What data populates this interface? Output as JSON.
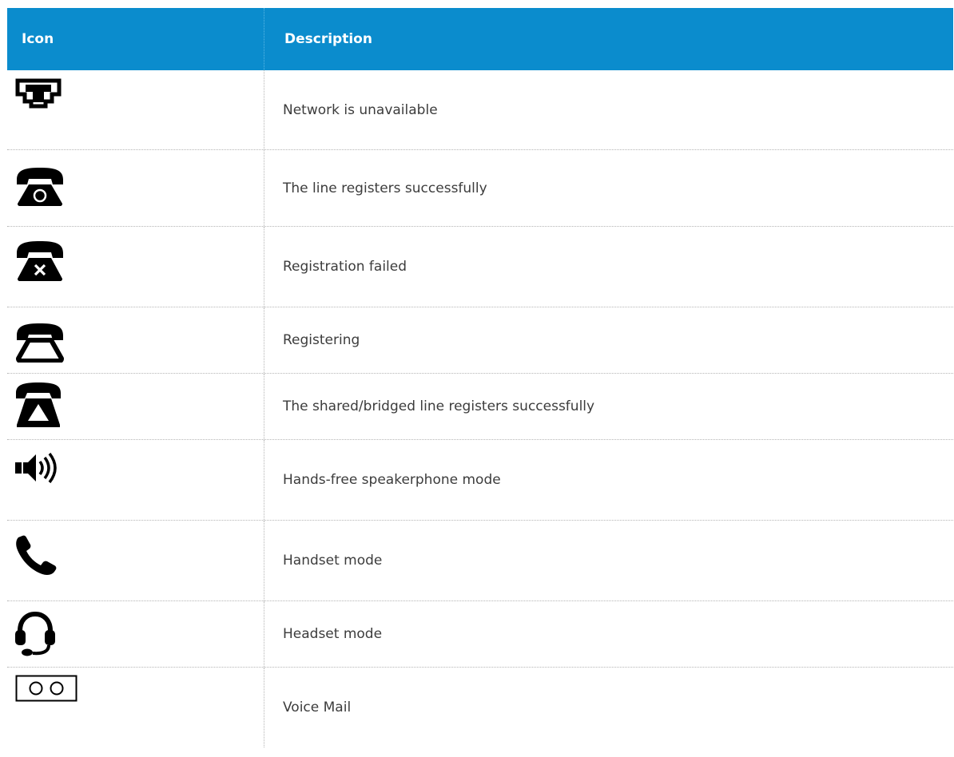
{
  "table": {
    "header": {
      "icon": "Icon",
      "description": "Description"
    },
    "rows": [
      {
        "icon": "network-unavailable-icon",
        "description": "Network is unavailable"
      },
      {
        "icon": "line-registered-icon",
        "description": "The line registers successfully"
      },
      {
        "icon": "registration-failed-icon",
        "description": "Registration failed"
      },
      {
        "icon": "registering-icon",
        "description": "Registering"
      },
      {
        "icon": "shared-line-registered-icon",
        "description": "The shared/bridged line registers successfully"
      },
      {
        "icon": "speakerphone-icon",
        "description": "Hands-free speakerphone mode"
      },
      {
        "icon": "handset-icon",
        "description": "Handset mode"
      },
      {
        "icon": "headset-icon",
        "description": "Headset mode"
      },
      {
        "icon": "voicemail-icon",
        "description": "Voice Mail"
      }
    ]
  },
  "colors": {
    "header_background": "#0b8ccd",
    "header_text": "#ffffff",
    "divider": "#b5b5b5",
    "icon": "#000000"
  }
}
